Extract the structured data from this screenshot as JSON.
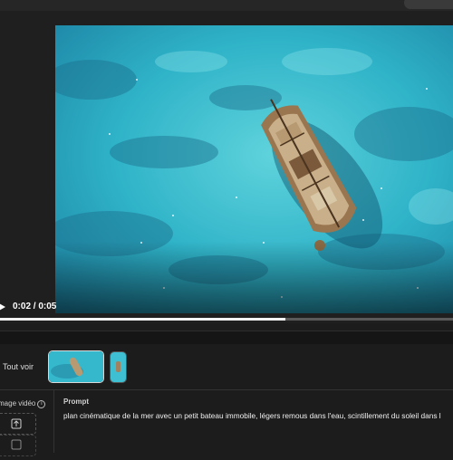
{
  "player": {
    "time": "0:02 / 0:05",
    "progress": 0.63,
    "accent": "#f2f2f2"
  },
  "thumbnails": {
    "see_all": "Tout voir"
  },
  "input": {
    "image_label": "mage vidéo",
    "info_icon": "ⓘ"
  },
  "prompt": {
    "label": "Prompt",
    "text": "plan cinématique de la mer avec un petit bateau immobile, légers remous dans l'eau, scintillement du soleil dans l"
  }
}
